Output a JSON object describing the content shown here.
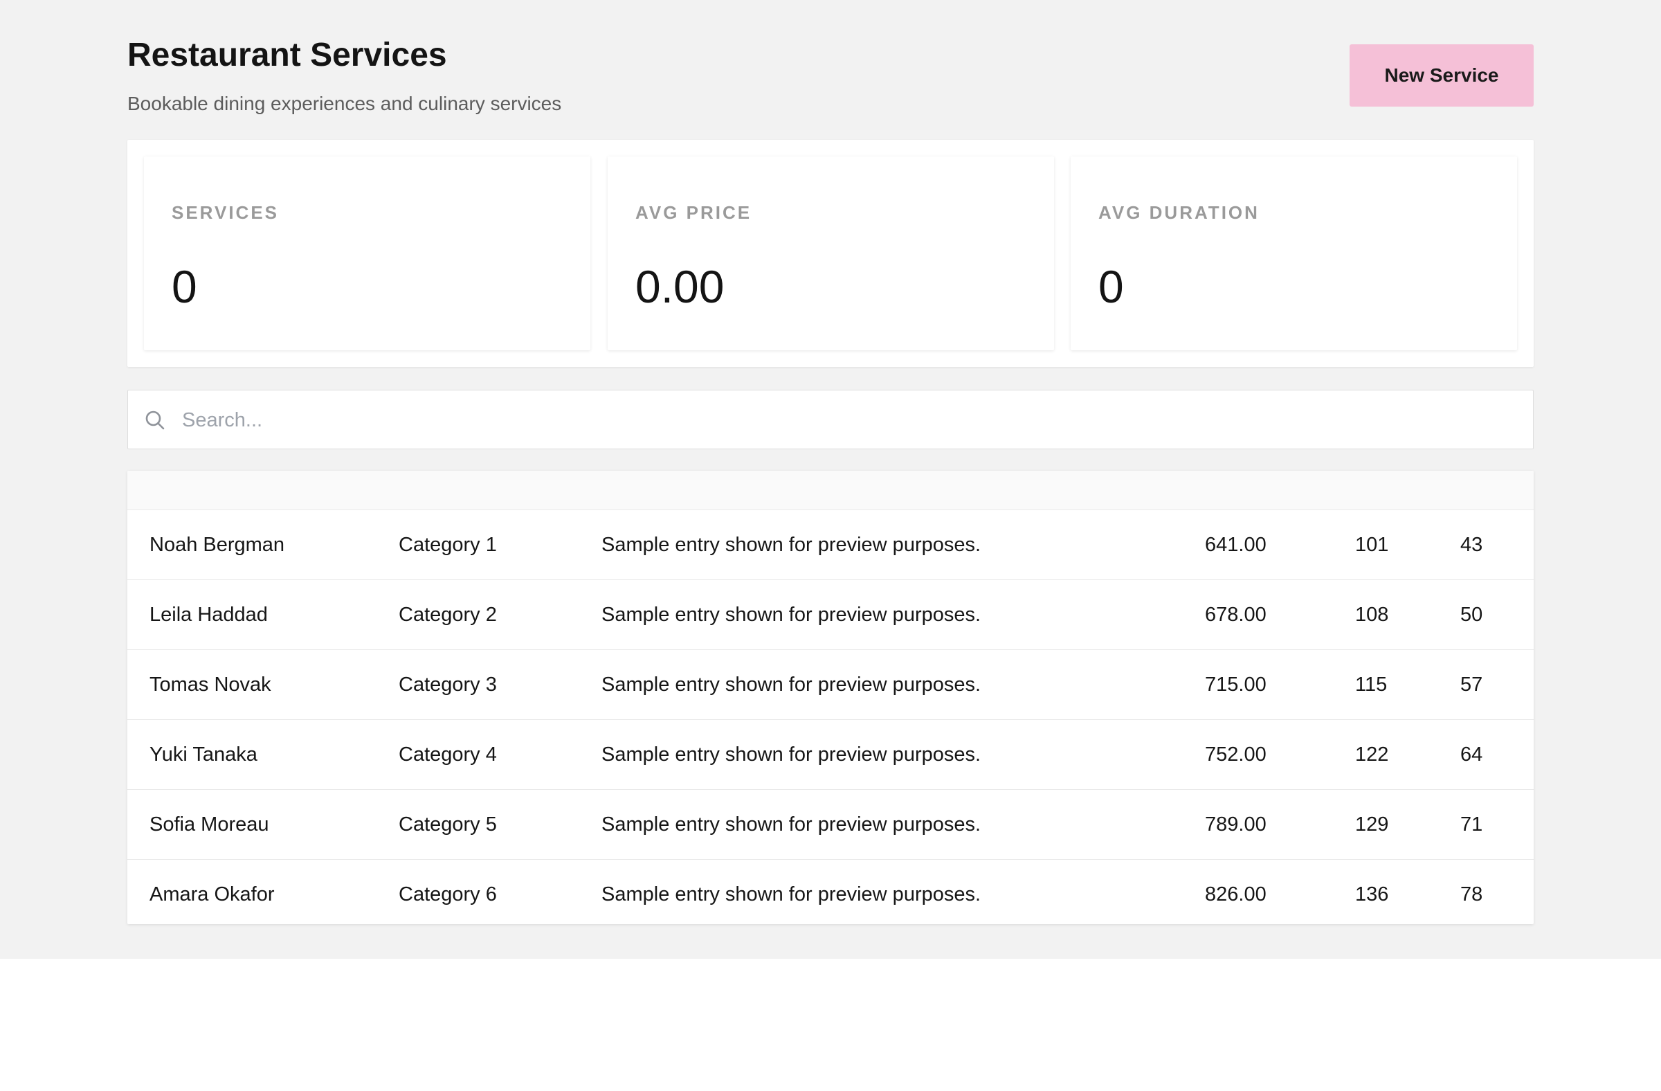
{
  "header": {
    "title": "Restaurant Services",
    "subtitle": "Bookable dining experiences and culinary services",
    "new_button_label": "New Service"
  },
  "stats": [
    {
      "label": "SERVICES",
      "value": "0"
    },
    {
      "label": "AVG PRICE",
      "value": "0.00"
    },
    {
      "label": "AVG DURATION",
      "value": "0"
    }
  ],
  "search": {
    "placeholder": "Search...",
    "value": "",
    "icon": "search-icon"
  },
  "table": {
    "rows": [
      {
        "name": "Noah Bergman",
        "category": "Category 1",
        "description": "Sample entry shown for preview purposes.",
        "price": "641.00",
        "duration": "101",
        "capacity": "43"
      },
      {
        "name": "Leila Haddad",
        "category": "Category 2",
        "description": "Sample entry shown for preview purposes.",
        "price": "678.00",
        "duration": "108",
        "capacity": "50"
      },
      {
        "name": "Tomas Novak",
        "category": "Category 3",
        "description": "Sample entry shown for preview purposes.",
        "price": "715.00",
        "duration": "115",
        "capacity": "57"
      },
      {
        "name": "Yuki Tanaka",
        "category": "Category 4",
        "description": "Sample entry shown for preview purposes.",
        "price": "752.00",
        "duration": "122",
        "capacity": "64"
      },
      {
        "name": "Sofia Moreau",
        "category": "Category 5",
        "description": "Sample entry shown for preview purposes.",
        "price": "789.00",
        "duration": "129",
        "capacity": "71"
      },
      {
        "name": "Amara Okafor",
        "category": "Category 6",
        "description": "Sample entry shown for preview purposes.",
        "price": "826.00",
        "duration": "136",
        "capacity": "78"
      }
    ]
  },
  "colors": {
    "background": "#f2f2f2",
    "accent_button": "#f5c0d7",
    "card": "#ffffff",
    "muted_label": "#9a9a9a"
  }
}
